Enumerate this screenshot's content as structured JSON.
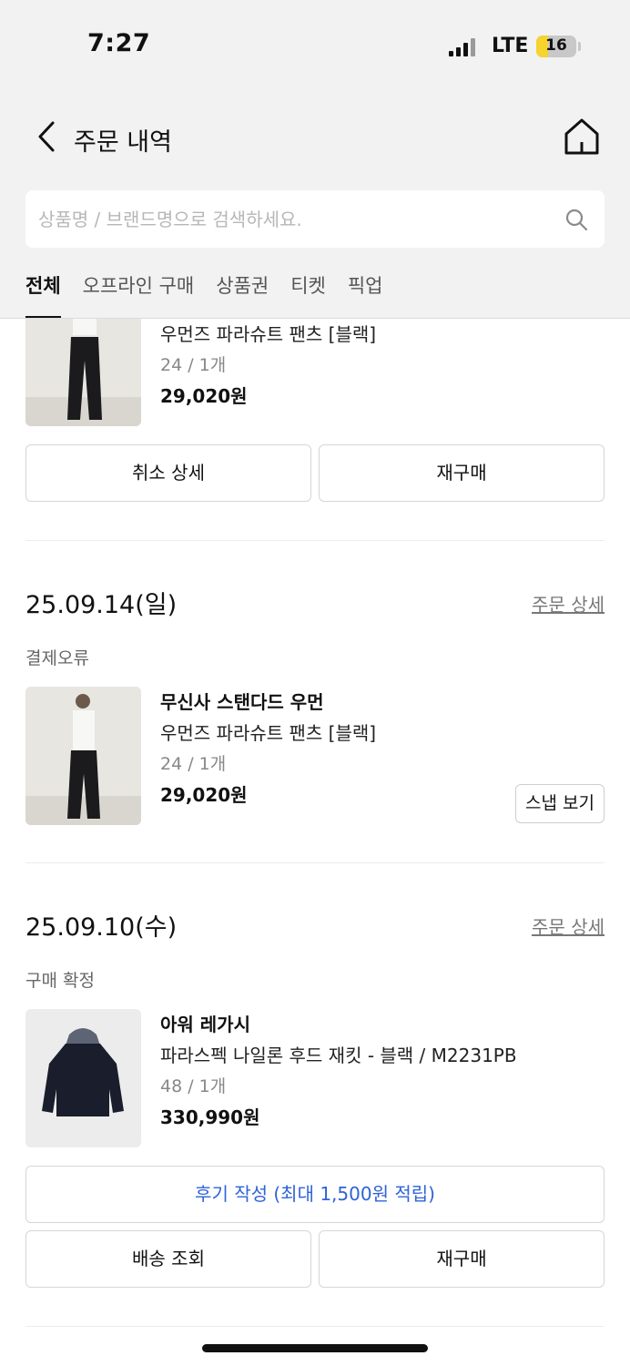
{
  "status_bar": {
    "time": "7:27",
    "network": "LTE",
    "battery": "16",
    "battery_level": 0.16
  },
  "header": {
    "title": "주문 내역"
  },
  "search": {
    "placeholder": "상품명 / 브랜드명으로 검색하세요."
  },
  "tabs": [
    {
      "label": "전체",
      "active": true
    },
    {
      "label": "오프라인 구매",
      "active": false
    },
    {
      "label": "상품권",
      "active": false
    },
    {
      "label": "티켓",
      "active": false
    },
    {
      "label": "픽업",
      "active": false
    }
  ],
  "orders": [
    {
      "item": {
        "name": "우먼즈 파라슈트 팬츠 [블랙]",
        "option": "24 / 1개",
        "price": "29,020원"
      },
      "buttons": [
        "취소 상세",
        "재구매"
      ]
    },
    {
      "date": "25.09.14(일)",
      "detail_link": "주문 상세",
      "status": "결제오류",
      "item": {
        "brand": "무신사 스탠다드 우먼",
        "name": "우먼즈 파라슈트 팬츠 [블랙]",
        "option": "24 / 1개",
        "price": "29,020원",
        "snap_button": "스냅 보기"
      }
    },
    {
      "date": "25.09.10(수)",
      "detail_link": "주문 상세",
      "status": "구매 확정",
      "item": {
        "brand": "아워 레가시",
        "name": "파라스펙 나일론 후드 재킷 - 블랙 / M2231PB",
        "option": "48 / 1개",
        "price": "330,990원"
      },
      "review_button": "후기 작성 (최대 1,500원 적립)",
      "buttons": [
        "배송 조회",
        "재구매"
      ]
    }
  ],
  "colors": {
    "accent_blue": "#2f63d7",
    "header_bg": "#f2f2f3"
  }
}
